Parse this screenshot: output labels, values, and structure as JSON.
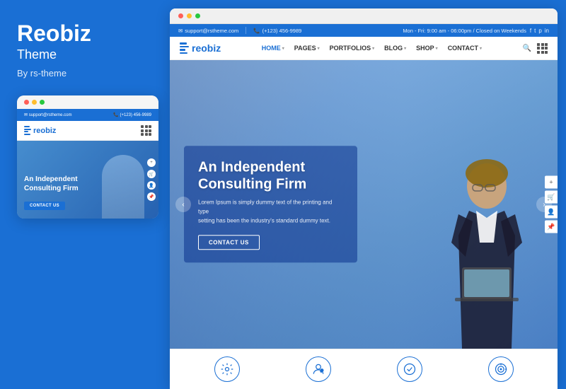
{
  "left": {
    "title": "Reobiz",
    "subtitle": "Theme",
    "by": "By rs-theme"
  },
  "mobile": {
    "email": "support@rstheme.com",
    "phone": "(+123) 456-9989",
    "logo": "reobiz",
    "hero_title": "An Independent\nConsulting Firm",
    "cta": "CONTACT US",
    "dots": [
      "•••"
    ]
  },
  "desktop": {
    "topbar": {
      "email": "support@rstheme.com",
      "phone": "(+123) 456-9989",
      "hours": "Mon - Fri: 9:00 am - 06:00pm / Closed on Weekends"
    },
    "nav": {
      "logo": "reobiz",
      "menu": [
        {
          "label": "HOME",
          "active": true,
          "has_dropdown": true
        },
        {
          "label": "PAGES",
          "active": false,
          "has_dropdown": true
        },
        {
          "label": "PORTFOLIOS",
          "active": false,
          "has_dropdown": true
        },
        {
          "label": "BLOG",
          "active": false,
          "has_dropdown": true
        },
        {
          "label": "SHOP",
          "active": false,
          "has_dropdown": true
        },
        {
          "label": "CONTACT",
          "active": false,
          "has_dropdown": true
        }
      ]
    },
    "hero": {
      "title": "An Independent\nConsulting Firm",
      "body": "Lorem Ipsum is simply dummy text of the printing and type\nsetting has been the industry's standard dummy text.",
      "cta": "CONTACT US"
    },
    "bottom_icons": [
      {
        "icon": "⚙",
        "label": ""
      },
      {
        "icon": "👤",
        "label": ""
      },
      {
        "icon": "✓",
        "label": ""
      },
      {
        "icon": "◎",
        "label": ""
      }
    ]
  },
  "browser": {
    "dots": [
      "red",
      "yellow",
      "green"
    ]
  }
}
